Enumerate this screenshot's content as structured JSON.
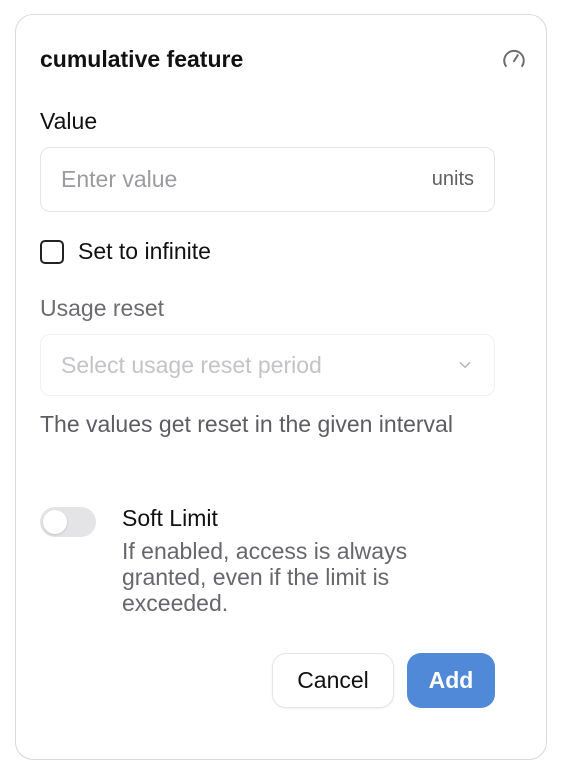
{
  "dialog": {
    "title": "cumulative feature",
    "icon": "gauge-icon"
  },
  "value_field": {
    "label": "Value",
    "placeholder": "Enter value",
    "value": "",
    "unit": "units"
  },
  "infinite_checkbox": {
    "label": "Set to infinite",
    "checked": false
  },
  "usage_reset": {
    "label": "Usage reset",
    "placeholder": "Select usage reset period",
    "help_text": "The values get reset in the given interval"
  },
  "soft_limit": {
    "title": "Soft Limit",
    "description": "If enabled, access is always granted, even if the limit is exceeded.",
    "enabled": false
  },
  "actions": {
    "cancel_label": "Cancel",
    "add_label": "Add"
  },
  "colors": {
    "primary": "#5089d8",
    "border": "#e4e4e7",
    "muted_text": "#6b6b70"
  }
}
